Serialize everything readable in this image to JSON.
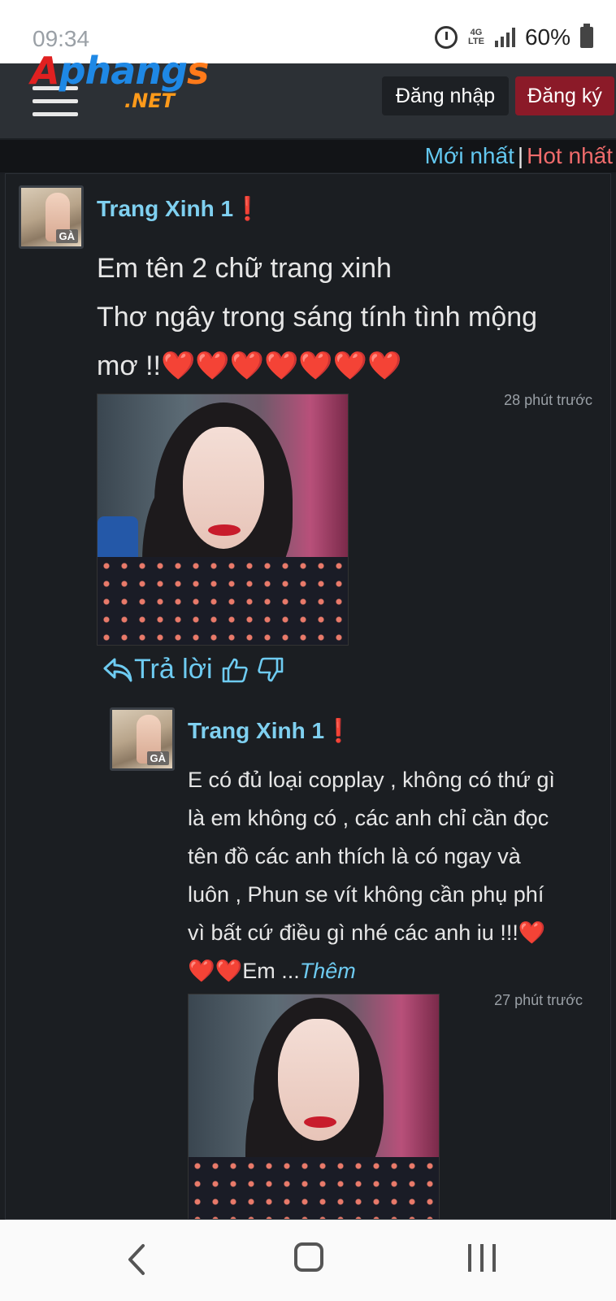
{
  "statusbar": {
    "time": "09:34",
    "network": "4G LTE",
    "battery": "60%"
  },
  "header": {
    "logo_part1": "A",
    "logo_part2": "phang",
    "logo_part3": "s",
    "logo_net": ".NET",
    "login_label": "Đăng nhập",
    "register_label": "Đăng ký",
    "login_bg": "#1d2024",
    "register_bg": "#8b1a28"
  },
  "sort": {
    "newest": "Mới nhất",
    "separator": "|",
    "hottest": "Hot nhất"
  },
  "post": {
    "avatar_tag": "GÀ",
    "username": "Trang Xinh 1",
    "status_mark": "❗",
    "line1": "Em tên 2 chữ trang xinh",
    "line2": "Thơ ngây trong sáng tính tình mộng",
    "line3": "mơ !!❤️❤️❤️❤️❤️❤️❤️",
    "time": "28 phút trước",
    "reply_label": "Trả lời"
  },
  "reply": {
    "avatar_tag": "GÀ",
    "username": "Trang Xinh 1",
    "status_mark": "❗",
    "lines": [
      "E có đủ loại copplay , không có thứ gì",
      "là em không có , các anh chỉ cần đọc",
      "tên đồ các anh thích là có ngay và",
      "luôn , Phun se vít không cần phụ phí",
      "vì bất cứ điều gì nhé các anh iu !!!❤️",
      "❤️❤️Em ..."
    ],
    "more_label": "Thêm",
    "time": "27 phút trước"
  },
  "colors": {
    "accent_blue": "#63c8f0",
    "hot_red": "#ef6b6b",
    "background": "#1b1e22"
  },
  "icons": [
    "alarm-icon",
    "network-icon",
    "signal-icon",
    "battery-icon",
    "menu-icon",
    "reply-arrow-icon",
    "thumbs-up-icon",
    "thumbs-down-icon",
    "back-icon",
    "home-icon",
    "recent-apps-icon"
  ]
}
